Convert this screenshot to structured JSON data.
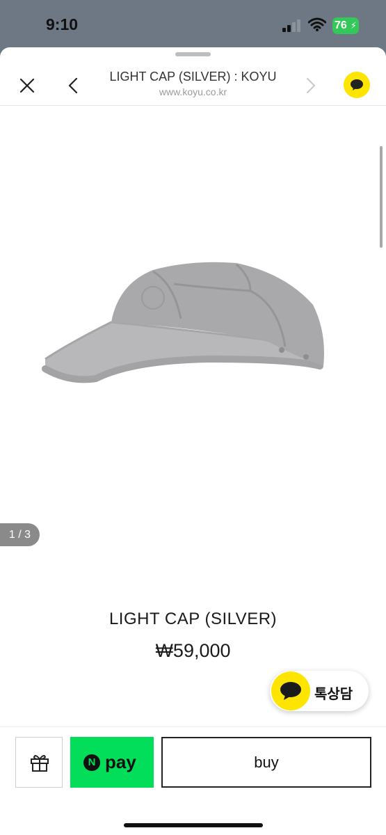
{
  "status_bar": {
    "time": "9:10",
    "battery": "76",
    "icons": [
      "cellular-signal-icon",
      "wifi-icon",
      "battery-charging-icon"
    ]
  },
  "nav": {
    "title": "LIGHT CAP (SILVER) : KOYU",
    "url": "www.koyu.co.kr",
    "icons": [
      "close-icon",
      "chevron-left-icon",
      "chevron-right-icon",
      "kakao-chat-icon"
    ]
  },
  "product": {
    "image_counter": "1 / 3",
    "name": "LIGHT CAP (SILVER)",
    "price": "₩59,000"
  },
  "chat": {
    "label": "톡상담"
  },
  "actions": {
    "npay_n": "N",
    "npay_label": "pay",
    "buy_label": "buy"
  },
  "colors": {
    "kakao_yellow": "#fee500",
    "npay_green": "#03de5a",
    "status_battery": "#34c759",
    "backdrop": "#6d7884"
  }
}
